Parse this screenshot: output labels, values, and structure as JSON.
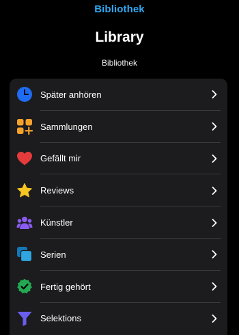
{
  "header": {
    "back_link": "Bibliothek",
    "title": "Library",
    "subtitle": "Bibliothek"
  },
  "list": {
    "items": [
      {
        "label": "Später anhören",
        "icon": "clock-icon"
      },
      {
        "label": "Sammlungen",
        "icon": "collections-icon"
      },
      {
        "label": "Gefällt mir",
        "icon": "heart-icon"
      },
      {
        "label": "Reviews",
        "icon": "star-icon"
      },
      {
        "label": "Künstler",
        "icon": "people-icon"
      },
      {
        "label": "Serien",
        "icon": "series-icon"
      },
      {
        "label": "Fertig gehört",
        "icon": "check-badge-icon"
      },
      {
        "label": "Selektions",
        "icon": "filter-icon"
      }
    ]
  },
  "colors": {
    "background": "#000000",
    "list_background": "#1c1c1e",
    "accent": "#31a8f2",
    "separator": "#3a3a3c"
  }
}
